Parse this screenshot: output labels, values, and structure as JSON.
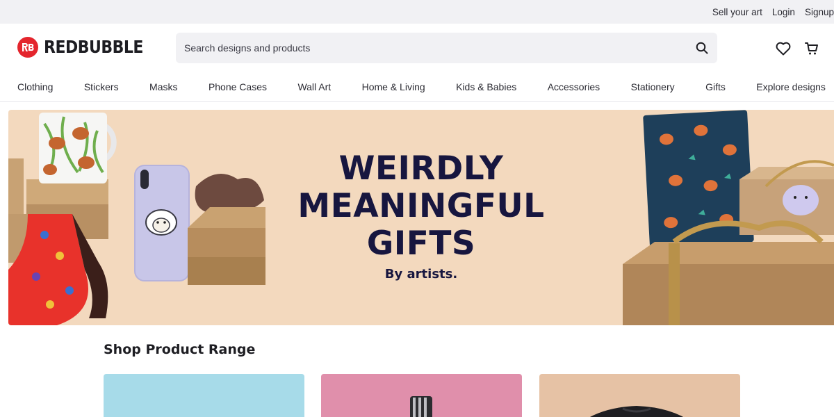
{
  "utility": {
    "sell": "Sell your art",
    "login": "Login",
    "signup": "Signup"
  },
  "header": {
    "logo_text": "REDBUBBLE",
    "search_placeholder": "Search designs and products",
    "icons": [
      "search-icon",
      "heart-icon",
      "cart-icon"
    ]
  },
  "nav": {
    "items": [
      "Clothing",
      "Stickers",
      "Masks",
      "Phone Cases",
      "Wall Art",
      "Home & Living",
      "Kids & Babies",
      "Accessories",
      "Stationery",
      "Gifts",
      "Explore designs"
    ]
  },
  "hero": {
    "title": "WEIRDLY\nMEANINGFUL\nGIFTS",
    "subtitle": "By artists."
  },
  "shop": {
    "title": "Shop Product Range"
  },
  "colors": {
    "brand": "#e4252d",
    "hero_bg": "#f3d9be",
    "hero_text": "#17163f",
    "card_1": "#a7dbe9",
    "card_2": "#e08fab",
    "card_3": "#e6c2a5"
  }
}
